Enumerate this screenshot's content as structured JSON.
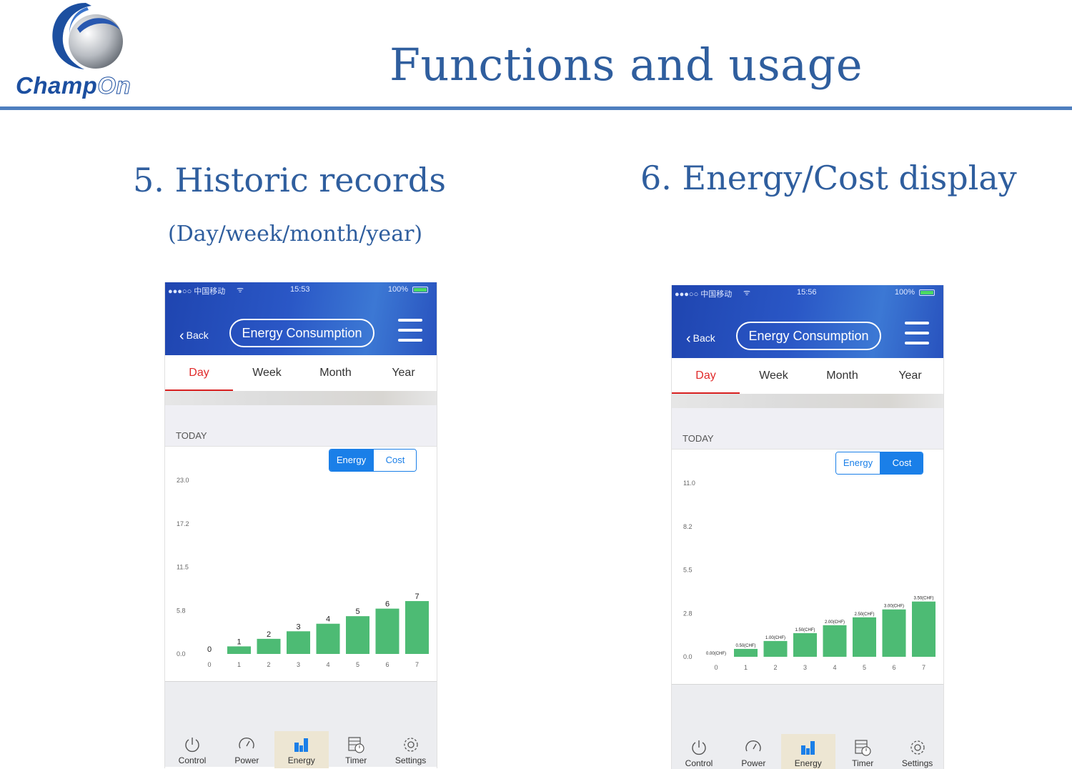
{
  "slide": {
    "title": "Functions and usage",
    "logo_text_a": "Champ",
    "logo_text_b": "On",
    "section5_title": "5. Historic records",
    "section5_sub": "(Day/week/month/year)",
    "section6_title": "6. Energy/Cost display"
  },
  "colors": {
    "brand_blue": "#2f5e9e",
    "header_blue": "#2a57c6",
    "bar_green": "#4dbb74",
    "tab_red": "#e02a2a",
    "accent": "#1a7fe8"
  },
  "phones": [
    {
      "status": {
        "carrier": "●●●○○ 中国移动",
        "time": "15:53",
        "battery": "100%"
      },
      "back_label": "Back",
      "title": "Energy Consumption",
      "tabs": [
        "Day",
        "Week",
        "Month",
        "Year"
      ],
      "active_tab": "Day",
      "today_label": "TODAY",
      "toggle": {
        "energy": "Energy",
        "cost": "Cost",
        "selected": "Energy"
      },
      "nav": [
        {
          "label": "Control",
          "icon": "power-icon"
        },
        {
          "label": "Power",
          "icon": "gauge-icon"
        },
        {
          "label": "Energy",
          "icon": "bar-chart-icon"
        },
        {
          "label": "Timer",
          "icon": "timer-icon"
        },
        {
          "label": "Settings",
          "icon": "gear-icon"
        }
      ],
      "active_nav": "Energy"
    },
    {
      "status": {
        "carrier": "●●●○○ 中国移动",
        "time": "15:56",
        "battery": "100%"
      },
      "back_label": "Back",
      "title": "Energy Consumption",
      "tabs": [
        "Day",
        "Week",
        "Month",
        "Year"
      ],
      "active_tab": "Day",
      "today_label": "TODAY",
      "toggle": {
        "energy": "Energy",
        "cost": "Cost",
        "selected": "Cost"
      },
      "nav": [
        {
          "label": "Control",
          "icon": "power-icon"
        },
        {
          "label": "Power",
          "icon": "gauge-icon"
        },
        {
          "label": "Energy",
          "icon": "bar-chart-icon"
        },
        {
          "label": "Timer",
          "icon": "timer-icon"
        },
        {
          "label": "Settings",
          "icon": "gear-icon"
        }
      ],
      "active_nav": "Energy"
    }
  ],
  "chart_data": [
    {
      "type": "bar",
      "categories": [
        "0",
        "1",
        "2",
        "3",
        "4",
        "5",
        "6",
        "7"
      ],
      "values": [
        0,
        1,
        2,
        3,
        4,
        5,
        6,
        7
      ],
      "data_labels": [
        "0",
        "1",
        "2",
        "3",
        "4",
        "5",
        "6",
        "7"
      ],
      "yticks": [
        "0.0",
        "5.8",
        "11.5",
        "17.2",
        "23.0"
      ],
      "ylim": [
        0,
        23.0
      ],
      "grid": false,
      "legend": "none"
    },
    {
      "type": "bar",
      "categories": [
        "0",
        "1",
        "2",
        "3",
        "4",
        "5",
        "6",
        "7"
      ],
      "values": [
        0,
        0.5,
        1.0,
        1.5,
        2.0,
        2.5,
        3.0,
        3.5
      ],
      "data_labels": [
        "0.00(CHF)",
        "0.50(CHF)",
        "1.00(CHF)",
        "1.50(CHF)",
        "2.00(CHF)",
        "2.50(CHF)",
        "3.00(CHF)",
        "3.50(CHF)"
      ],
      "yticks": [
        "0.0",
        "2.8",
        "5.5",
        "8.2",
        "11.0"
      ],
      "ylim": [
        0,
        11.0
      ],
      "grid": false,
      "legend": "none"
    }
  ]
}
